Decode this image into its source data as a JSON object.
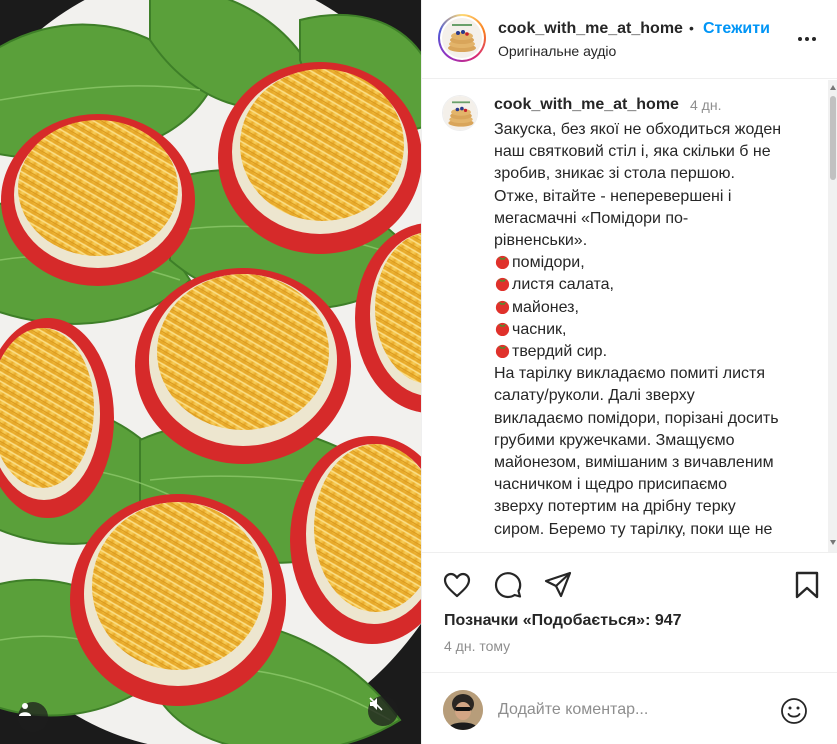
{
  "post": {
    "username": "cook_with_me_at_home",
    "separator": "•",
    "follow_label": "Стежити",
    "audio_label": "Оригінальне аудіо",
    "more_icon": "more-horizontal-icon"
  },
  "caption": {
    "username": "cook_with_me_at_home",
    "time": "4 дн.",
    "lines": [
      "Закуска, без якої не обходиться жоден",
      "наш святковий стіл і, яка скільки б не",
      "зробив, зникає зі стола першою.",
      "Отже, вітайте - неперевершені і",
      "мегасмачні «Помідори по-",
      "рівненськи».",
      "помідори,",
      "листя салата,",
      "майонез,",
      "часник,",
      "твердий сир.",
      "На тарілку викладаємо помиті листя",
      "салату/руколи. Далі зверху",
      "викладаємо помідори, порізані досить",
      "грубими кружечками. Змащуємо",
      "майонезом, вимішаним з вичавленим",
      "часничком і щедро присипаємо",
      "зверху потертим на дрібну терку",
      "сиром. Беремо ту тарілку, поки ще не"
    ],
    "bullet_icon": "tomato-emoji-icon"
  },
  "actions": {
    "like_icon": "heart-icon",
    "comment_icon": "comment-icon",
    "share_icon": "send-icon",
    "save_icon": "bookmark-icon"
  },
  "likes": {
    "label": "Позначки «Подобається»:",
    "count": "947"
  },
  "posted_ago": "4 дн. тому",
  "comment": {
    "placeholder": "Додайте коментар...",
    "emoji_icon": "smiley-icon"
  },
  "media": {
    "user_tag_icon": "user-tag-icon",
    "mute_icon": "muted-speaker-icon"
  },
  "colors": {
    "accent": "#0095f6",
    "text": "#262626",
    "muted": "#8e8e8e"
  }
}
